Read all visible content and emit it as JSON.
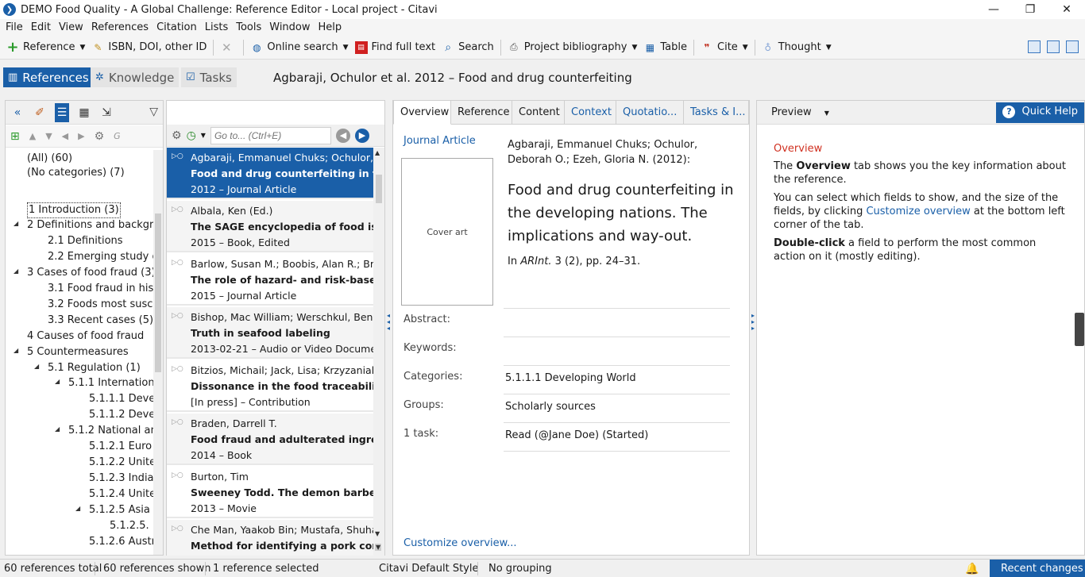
{
  "window": {
    "title": "DEMO Food Quality - A Global Challenge: Reference Editor - Local project - Citavi",
    "controls": [
      "—",
      "❐",
      "✕"
    ]
  },
  "menu": [
    "File",
    "Edit",
    "View",
    "References",
    "Citation",
    "Lists",
    "Tools",
    "Window",
    "Help"
  ],
  "toolbar": {
    "reference": "Reference",
    "isbn": "ISBN, DOI, other ID",
    "online_search": "Online search",
    "find_full_text": "Find full text",
    "search": "Search",
    "project_bibliography": "Project bibliography",
    "table": "Table",
    "cite": "Cite",
    "thought": "Thought"
  },
  "nav": {
    "references": "References",
    "knowledge": "Knowledge",
    "tasks": "Tasks",
    "heading": "Agbaraji, Ochulor et al. 2012 – Food and drug counterfeiting"
  },
  "categories": [
    {
      "label": "(All) (60)"
    },
    {
      "label": "(No categories) (7)"
    },
    {
      "label": "1 Introduction (3)"
    },
    {
      "label": "2 Definitions and backgro"
    },
    {
      "label": "2.1 Definitions"
    },
    {
      "label": "2.2 Emerging study o"
    },
    {
      "label": "3 Cases of food fraud (3)"
    },
    {
      "label": "3.1 Food fraud in hist"
    },
    {
      "label": "3.2 Foods most susce"
    },
    {
      "label": "3.3 Recent cases (5)"
    },
    {
      "label": "4 Causes of food fraud"
    },
    {
      "label": "5 Countermeasures"
    },
    {
      "label": "5.1 Regulation (1)"
    },
    {
      "label": "5.1.1 Internation"
    },
    {
      "label": "5.1.1.1 Devel"
    },
    {
      "label": "5.1.1.2 Devel"
    },
    {
      "label": "5.1.2 National an"
    },
    {
      "label": "5.1.2.1 Euro"
    },
    {
      "label": "5.1.2.2 Unite"
    },
    {
      "label": "5.1.2.3 India"
    },
    {
      "label": "5.1.2.4 Unite"
    },
    {
      "label": "5.1.2.5 Asia ("
    },
    {
      "label": "5.1.2.5."
    },
    {
      "label": "5.1.2.6 Austr"
    }
  ],
  "ref_pane": {
    "goto_placeholder": "Go to... (Ctrl+E)"
  },
  "references": [
    {
      "authors": "Agbaraji, Emmanuel Chuks; Ochulor,",
      "title": "Food and drug counterfeiting in the d",
      "meta": "2012 – Journal Article"
    },
    {
      "authors": "Albala, Ken (Ed.)",
      "title": "The SAGE encyclopedia of food issue",
      "meta": "2015 – Book, Edited"
    },
    {
      "authors": "Barlow, Susan M.; Boobis, Alan R.; Brid",
      "title": "The role of hazard- and risk-based ap",
      "meta": "2015 – Journal Article"
    },
    {
      "authors": "Bishop, Mac William; Werschkul, Ben;",
      "title": "Truth in seafood labeling",
      "meta": "2013-02-21 – Audio or Video Docume"
    },
    {
      "authors": "Bitzios, Michail; Jack, Lisa; Krzyzaniak,",
      "title": "Dissonance in the food traceability re",
      "meta": "[In press] – Contribution"
    },
    {
      "authors": "Braden, Darrell T.",
      "title": "Food fraud and adulterated ingredie",
      "meta": "2014 – Book"
    },
    {
      "authors": "Burton, Tim",
      "title": "Sweeney Todd. The demon barber of",
      "meta": "2013 – Movie"
    },
    {
      "authors": "Che Man, Yaakob Bin; Mustafa, Shuhai",
      "title": "Method for identifying a pork conten",
      "meta": ""
    }
  ],
  "overview": {
    "tabs": [
      "Overview",
      "Reference",
      "Content",
      "Context",
      "Quotatio...",
      "Tasks & I..."
    ],
    "type": "Journal Article",
    "cover_art": "Cover art",
    "authors": "Agbaraji, Emmanuel Chuks; Ochulor, Deborah O.; Ezeh, Gloria N. (2012):",
    "title": "Food and drug counterfeiting in the developing nations. The implications and way-out.",
    "source_prefix": "In ",
    "source_journal": "ARInt.",
    "source_suffix": " 3 (2), pp. 24–31.",
    "fields": [
      {
        "label": "Abstract:",
        "value": ""
      },
      {
        "label": "Keywords:",
        "value": ""
      },
      {
        "label": "Categories:",
        "value": "5.1.1.1 Developing World"
      },
      {
        "label": "Groups:",
        "value": "Scholarly sources"
      },
      {
        "label": "1 task:",
        "value": "Read (@Jane Doe) (Started)"
      }
    ],
    "customize": "Customize overview..."
  },
  "help": {
    "preview": "Preview",
    "quick_help": "Quick Help",
    "heading": "Overview",
    "p1_pre": "The ",
    "p1_bold": "Overview",
    "p1_post": " tab shows you the key information about the reference.",
    "p2_pre": "You can select which fields to show, and the size of the fields, by clicking ",
    "p2_link": "Customize overview",
    "p2_post": " at the bottom left corner of the tab.",
    "p3_bold": "Double-click",
    "p3_post": " a field to perform the most common action on it (mostly editing)."
  },
  "status": {
    "total": "60 references total",
    "shown": "60 references shown",
    "selected": "1 reference selected",
    "style": "Citavi Default Style",
    "grouping": "No grouping",
    "recent_changes": "Recent changes"
  },
  "colors": {
    "accent": "#1a5fa8",
    "help_heading": "#d03020"
  }
}
